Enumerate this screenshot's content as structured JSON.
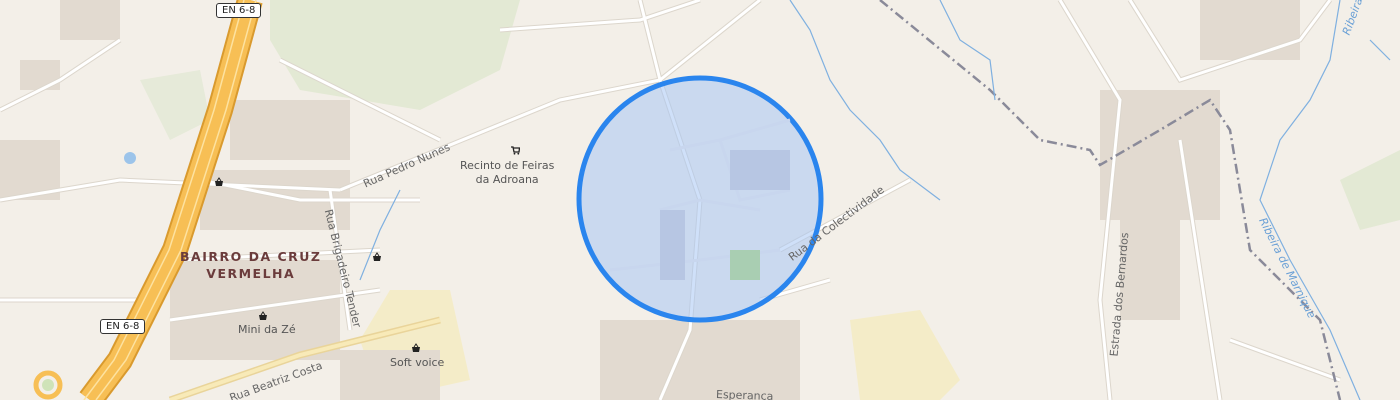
{
  "map": {
    "colors": {
      "background": "#f3efe8",
      "motorway": "#f5b94a",
      "road": "#ffffff",
      "road_casing": "#dcd6cc",
      "building": "#e4ddd3",
      "park": "#e0e8cf",
      "water": "#6aa0d6",
      "boundary": "#8a8a99",
      "selection_fill": "#a7c6f4",
      "selection_stroke": "#2a85ee",
      "district_label": "#6b3c3c",
      "sand": "#f2e8c0"
    },
    "road_shields": [
      "EN 6-8",
      "EN 6-8"
    ],
    "district": {
      "line1": "BAIRRO DA CRUZ",
      "line2": "VERMELHA"
    },
    "streets": {
      "pedro_nunes": "Rua Pedro Nunes",
      "brigadeiro": "Rua Brigadeiro Tender",
      "beatriz": "Rua Beatriz Costa",
      "colectividade": "Rua da Colectividade",
      "bernardos": "Estrada dos Bernardos",
      "esperanca": "Esperança"
    },
    "rivers": {
      "ribeira_top": "Ribeira",
      "ribeira_main": "Ribeira de Marnique"
    },
    "pois": [
      {
        "name": "recinto",
        "label_line1": "Recinto de Feiras",
        "label_line2": "da Adroana",
        "icon": "shopping-cart-icon"
      },
      {
        "name": "mini-da-ze",
        "label": "Mini da Zé",
        "icon": "shopping-basket-icon"
      },
      {
        "name": "soft-voice",
        "label": "Soft voice",
        "icon": "shopping-basket-icon"
      }
    ],
    "selection_circle": {
      "shape": "circle"
    }
  }
}
